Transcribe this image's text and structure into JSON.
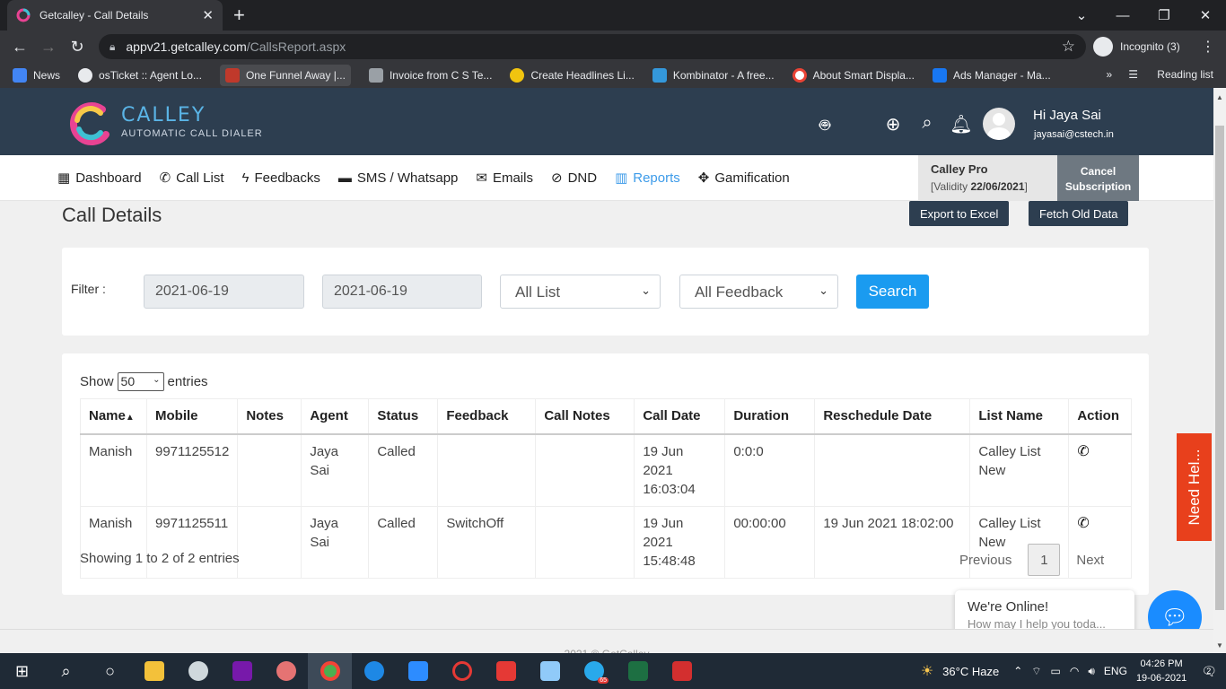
{
  "browser": {
    "tab_title": "Getcalley - Call Details",
    "url_domain": "appv21.getcalley.com",
    "url_path": "/CallsReport.aspx",
    "incognito_label": "Incognito (3)",
    "bookmarks": [
      {
        "label": "News",
        "color": "#4285f4"
      },
      {
        "label": "osTicket :: Agent Lo...",
        "color": "#e8eaed"
      },
      {
        "label": "One Funnel Away |...",
        "color": "#c0392b"
      },
      {
        "label": "Invoice from C S Te...",
        "color": "#9aa0a6"
      },
      {
        "label": "Create Headlines Li...",
        "color": "#f1c40f"
      },
      {
        "label": "Kombinator - A free...",
        "color": "#3498db"
      },
      {
        "label": "About Smart Displa...",
        "color": "#ea4335"
      },
      {
        "label": "Ads Manager - Ma...",
        "color": "#1877f2"
      }
    ],
    "more_bookmarks": "»",
    "reading_list": "Reading list"
  },
  "app": {
    "logo_title": "CALLEY",
    "logo_subtitle": "AUTOMATIC CALL DIALER",
    "greeting": "Hi Jaya Sai",
    "email": "jayasai@cstech.in",
    "header_icons": [
      "android-icon",
      "apple-icon",
      "support-icon",
      "search-icon",
      "bell-icon"
    ]
  },
  "menu": [
    {
      "label": "Dashboard",
      "icon": "▦",
      "active": false
    },
    {
      "label": "Call List",
      "icon": "✆",
      "active": false
    },
    {
      "label": "Feedbacks",
      "icon": "ϟ",
      "active": false
    },
    {
      "label": "SMS / Whatsapp",
      "icon": "▬",
      "active": false
    },
    {
      "label": "Emails",
      "icon": "✉",
      "active": false
    },
    {
      "label": "DND",
      "icon": "⊘",
      "active": false
    },
    {
      "label": "Reports",
      "icon": "▥",
      "active": true
    },
    {
      "label": "Gamification",
      "icon": "✥",
      "active": false
    }
  ],
  "plan": {
    "title": "Calley Pro",
    "validity_prefix": "[Validity ",
    "validity_date": "22/06/2021",
    "validity_suffix": "]",
    "cancel_line1": "Cancel",
    "cancel_line2": "Subscription"
  },
  "page": {
    "title": "Call Details",
    "export_label": "Export to Excel",
    "fetch_label": "Fetch Old Data"
  },
  "filter": {
    "label": "Filter :",
    "from_date": "2021-06-19",
    "to_date": "2021-06-19",
    "list_value": "All List",
    "feedback_value": "All Feedback",
    "search_label": "Search"
  },
  "table": {
    "show_label": "Show",
    "entries_value": "50",
    "entries_label": "entries",
    "columns": [
      "Name",
      "Mobile",
      "Notes",
      "Agent",
      "Status",
      "Feedback",
      "Call Notes",
      "Call Date",
      "Duration",
      "Reschedule Date",
      "List Name",
      "Action"
    ],
    "sort_indicator": "▲",
    "rows": [
      {
        "name": "Manish",
        "mobile": "9971125512",
        "notes": "",
        "agent": "Jaya Sai",
        "status": "Called",
        "feedback": "",
        "call_notes": "",
        "call_date_1": "19 Jun 2021",
        "call_date_2": "16:03:04",
        "duration": "0:0:0",
        "reschedule": "",
        "list_1": "Calley List",
        "list_2": "New"
      },
      {
        "name": "Manish",
        "mobile": "9971125511",
        "notes": "",
        "agent": "Jaya Sai",
        "status": "Called",
        "feedback": "SwitchOff",
        "call_notes": "",
        "call_date_1": "19 Jun 2021",
        "call_date_2": "15:48:48",
        "duration": "00:00:00",
        "reschedule": "19 Jun 2021 18:02:00",
        "list_1": "Calley List",
        "list_2": "New"
      }
    ],
    "info": "Showing 1 to 2 of 2 entries",
    "prev_label": "Previous",
    "page_number": "1",
    "next_label": "Next"
  },
  "widgets": {
    "need_help": "Need Hel...",
    "chat_title": "We're Online!",
    "chat_sub": "How may I help you toda...",
    "footer_text": "2021 © GetCalley"
  },
  "taskbar": {
    "weather": "36°C  Haze",
    "language": "ENG",
    "time": "04:26 PM",
    "date": "19-06-2021",
    "notifications": "2",
    "telegram_badge": "65"
  }
}
